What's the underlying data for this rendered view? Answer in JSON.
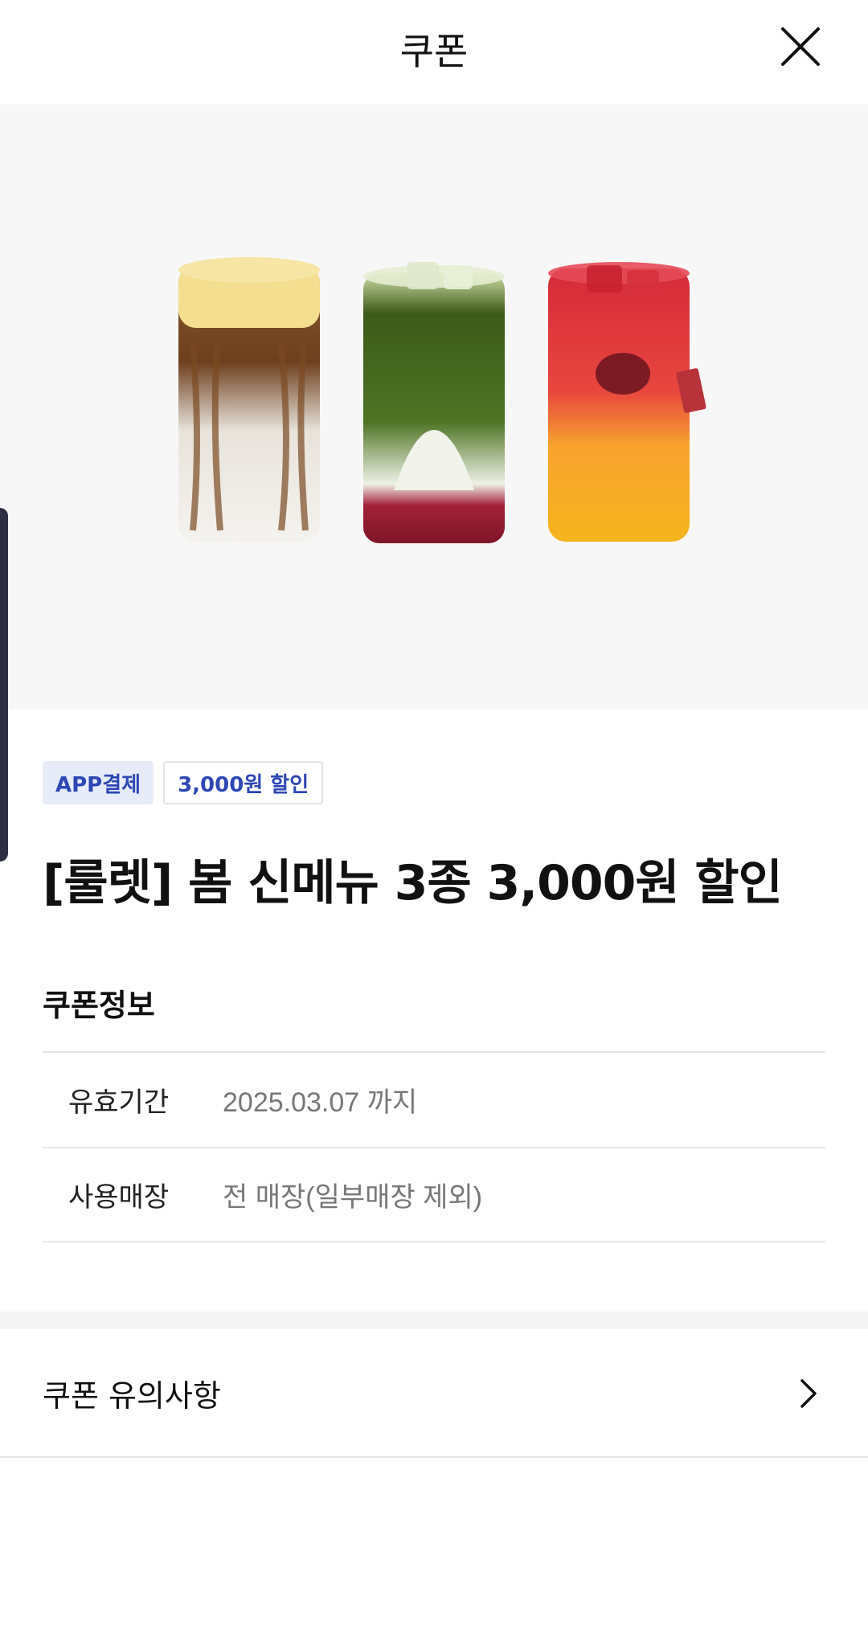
{
  "header": {
    "title": "쿠폰",
    "close_icon": "close-icon"
  },
  "hero": {
    "image_description_icon": "three-drinks-image"
  },
  "badges": {
    "payment": "APP결제",
    "discount": "3,000원 할인"
  },
  "coupon": {
    "title": "[룰렛] 봄 신메뉴 3종 3,000원 할인"
  },
  "info": {
    "section_title": "쿠폰정보",
    "rows": [
      {
        "label": "유효기간",
        "value": "2025.03.07 까지"
      },
      {
        "label": "사용매장",
        "value": "전 매장(일부매장 제외)"
      }
    ]
  },
  "notice": {
    "label": "쿠폰 유의사항",
    "icon": "chevron-right-icon"
  },
  "colors": {
    "accent_blue": "#2d47b4",
    "badge_bg": "#e7ebf7",
    "hero_bg": "#f7f7f7"
  }
}
